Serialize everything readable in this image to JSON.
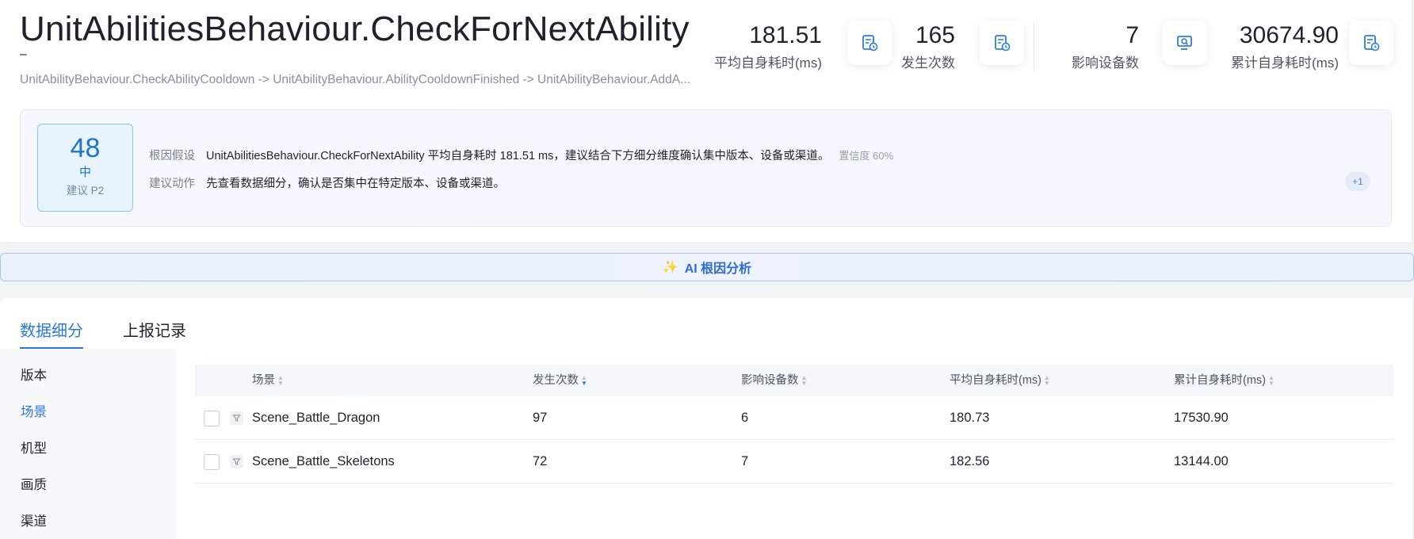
{
  "header": {
    "title": "UnitAbilitiesBehaviour.CheckForNextAbility",
    "dash": "–",
    "call_path": "UnitAbilityBehaviour.CheckAbilityCooldown -> UnitAbilityBehaviour.AbilityCooldownFinished -> UnitAbilityBehaviour.AddA..."
  },
  "stats": [
    {
      "value": "181.51",
      "label": "平均自身耗时(ms)",
      "icon": "report-clock-icon"
    },
    {
      "value": "165",
      "label": "发生次数",
      "icon": "report-clock-icon"
    },
    {
      "value": "7",
      "label": "影响设备数",
      "icon": "device-search-icon"
    },
    {
      "value": "30674.90",
      "label": "累计自身耗时(ms)",
      "icon": "report-clock-icon"
    }
  ],
  "hypothesis": {
    "score": "48",
    "level": "中",
    "suggest": "建议 P2",
    "root_cause_label": "根因假设",
    "root_cause_text": "UnitAbilitiesBehaviour.CheckForNextAbility 平均自身耗时 181.51 ms，建议结合下方细分维度确认集中版本、设备或渠道。",
    "confidence": "置信度 60%",
    "action_label": "建议动作",
    "action_text": "先查看数据细分，确认是否集中在特定版本、设备或渠道。",
    "more": "+1"
  },
  "ai_button": {
    "label": "AI 根因分析",
    "icon": "sparkle-icon"
  },
  "tabs": [
    {
      "label": "数据细分",
      "active": true
    },
    {
      "label": "上报记录",
      "active": false
    }
  ],
  "dimensions": [
    {
      "label": "版本",
      "active": false
    },
    {
      "label": "场景",
      "active": true
    },
    {
      "label": "机型",
      "active": false
    },
    {
      "label": "画质",
      "active": false
    },
    {
      "label": "渠道",
      "active": false
    }
  ],
  "table": {
    "columns": [
      "场景",
      "发生次数",
      "影响设备数",
      "平均自身耗时(ms)",
      "累计自身耗时(ms)"
    ],
    "rows": [
      {
        "scene": "Scene_Battle_Dragon",
        "count": "97",
        "devices": "6",
        "avg": "180.73",
        "total": "17530.90"
      },
      {
        "scene": "Scene_Battle_Skeletons",
        "count": "72",
        "devices": "7",
        "avg": "182.56",
        "total": "13144.00"
      }
    ]
  },
  "colors": {
    "accent": "#2878e0",
    "score_blue": "#1f73c8",
    "ai_border": "#a9c4ee"
  }
}
